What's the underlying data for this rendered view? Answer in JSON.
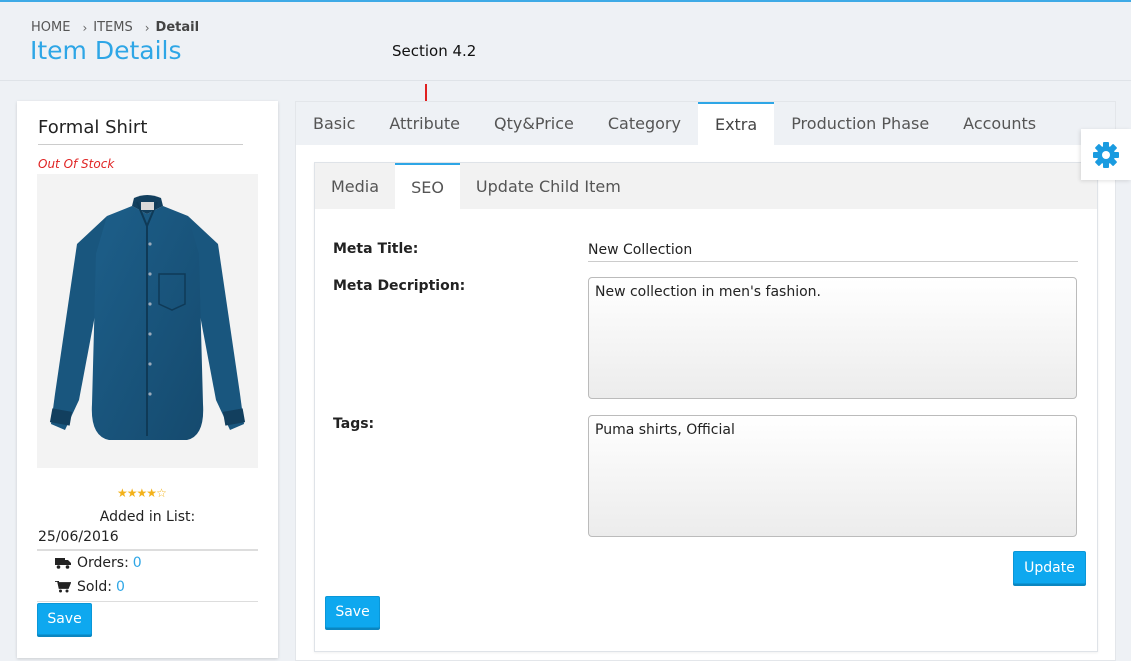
{
  "breadcrumb": {
    "home": "HOME",
    "items": "ITEMS",
    "detail": "Detail"
  },
  "page_title": "Item Details",
  "annotation": "Section 4.2",
  "product": {
    "name": "Formal Shirt",
    "stock_status": "Out Of Stock",
    "rating": 4,
    "rating_max": 5,
    "added_label": "Added in List:",
    "added_date": "25/06/2016",
    "orders_label": "Orders:",
    "orders_value": "0",
    "sold_label": "Sold:",
    "sold_value": "0",
    "save_label": "Save"
  },
  "tabs": [
    "Basic",
    "Attribute",
    "Qty&Price",
    "Category",
    "Extra",
    "Production Phase",
    "Accounts"
  ],
  "active_tab": "Extra",
  "subtabs": [
    "Media",
    "SEO",
    "Update Child Item"
  ],
  "active_subtab": "SEO",
  "seo_form": {
    "meta_title_label": "Meta Title:",
    "meta_title_value": "New Collection",
    "meta_description_label": "Meta Decription:",
    "meta_description_value": "New collection in men's fashion.",
    "tags_label": "Tags:",
    "tags_value": "Puma shirts, Official",
    "update_label": "Update",
    "save_label": "Save"
  },
  "colors": {
    "accent": "#2ea6e6",
    "button": "#0ea8ef",
    "out_of_stock": "#e02424",
    "star": "#f3b21b",
    "annotation_arrow": "#e02020"
  },
  "icons": {
    "orders": "truck-icon",
    "sold": "cart-icon",
    "settings": "gear-icon"
  }
}
